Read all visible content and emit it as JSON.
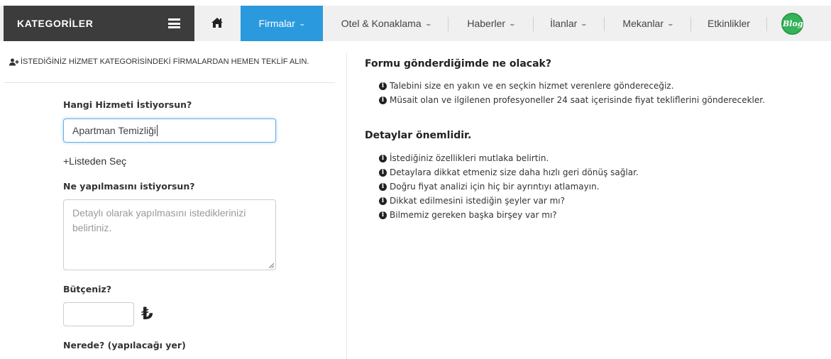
{
  "nav": {
    "categories_title": "KATEGORİLER",
    "items": [
      {
        "label": "Firmalar",
        "active": true
      },
      {
        "label": "Otel & Konaklama"
      },
      {
        "label": "Haberler"
      },
      {
        "label": "İlanlar"
      },
      {
        "label": "Mekanlar"
      },
      {
        "label": "Etkinlikler"
      }
    ],
    "blog_label": "Blog",
    "icons": {
      "menu": "hamburger-icon",
      "home": "home-icon",
      "chevron": "chevron-down-icon"
    },
    "colors": {
      "dark": "#3c3c3c",
      "active": "#2b99dd",
      "bar": "#f0f0f0",
      "blog": "#35b35a"
    }
  },
  "form": {
    "header": "İSTEDİĞİNİZ HİZMET KATEGORİSİNDEKİ FİRMALARDAN HEMEN TEKLİF ALIN.",
    "service_label": "Hangi Hizmeti İstiyorsun?",
    "service_value": "Apartman Temizliği",
    "list_link": "+Listeden Seç",
    "details_label": "Ne yapılmasını istiyorsun?",
    "details_placeholder": "Detaylı olarak yapılmasını istediklerinizi belirtiniz.",
    "budget_label": "Bütçeniz?",
    "budget_value": "",
    "currency_symbol": "₺",
    "location_label": "Nerede? (yapılacağı yer)"
  },
  "info": {
    "section1_title": "Formu gönderdiğimde ne olacak?",
    "section1_items": [
      "Talebini size en yakın ve en seçkin hizmet verenlere göndereceğiz.",
      "Müsait olan ve ilgilenen profesyoneller 24 saat içerisinde fiyat tekliflerini gönderecekler."
    ],
    "section2_title": "Detaylar önemlidir.",
    "section2_items": [
      "İstediğiniz özellikleri mutlaka belirtin.",
      "Detaylara dikkat etmeniz size daha hızlı geri dönüş sağlar.",
      "Doğru fiyat analizi için hiç bir ayrıntıyı atlamayın.",
      "Dikkat edilmesini istediğin şeyler var mı?",
      "Bilmemiz gereken başka birşey var mı?"
    ]
  }
}
